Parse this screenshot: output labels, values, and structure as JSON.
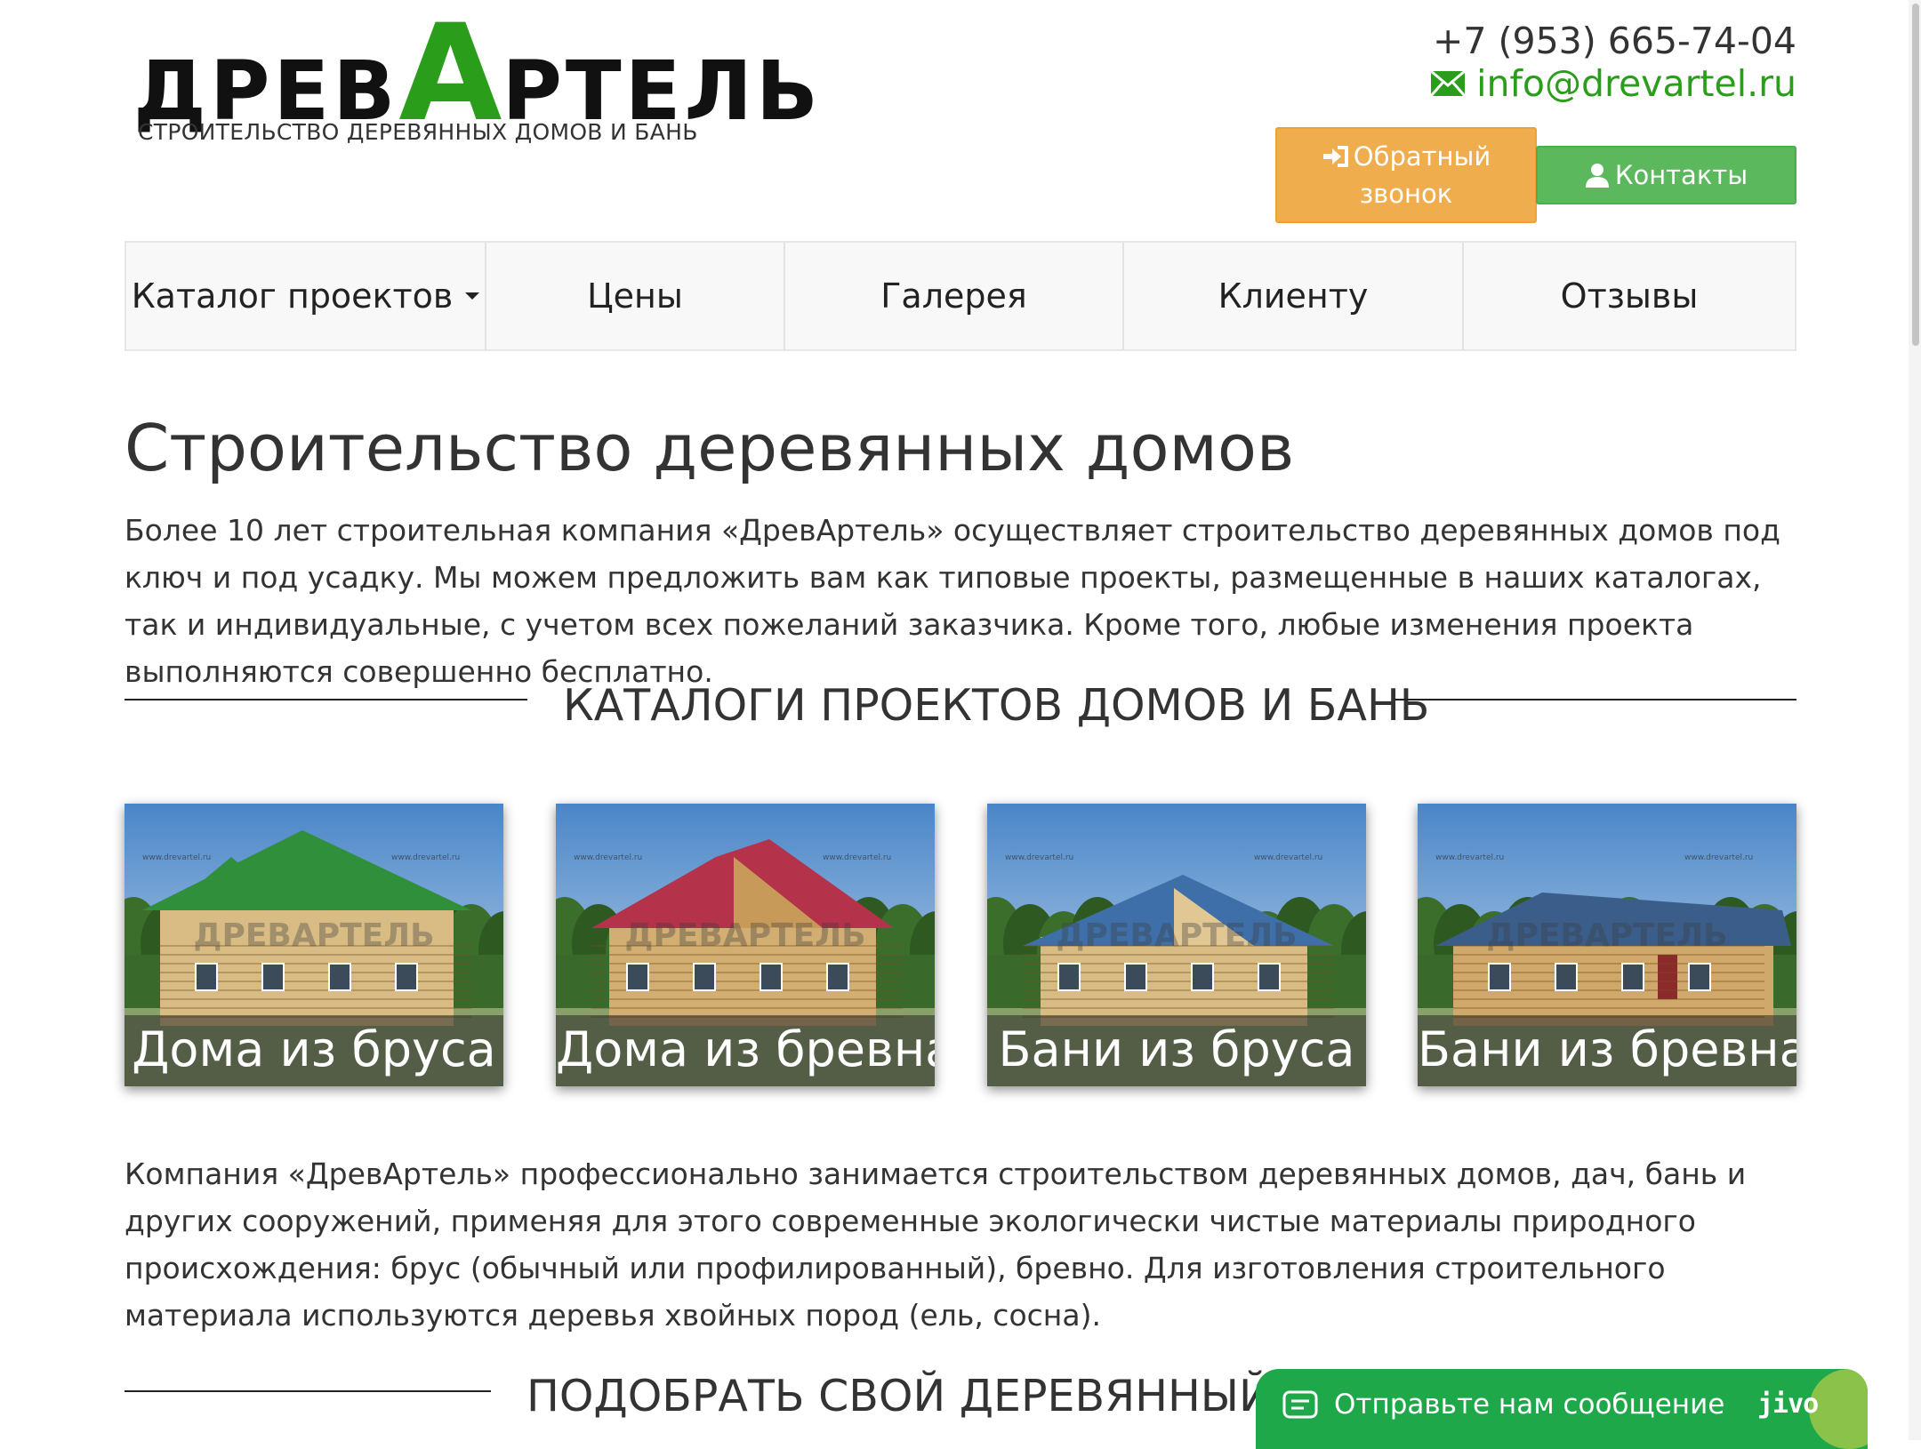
{
  "header": {
    "logo": {
      "part1": "ДРЕВ",
      "letter": "А",
      "part2": "РТЕЛЬ",
      "subtitle": "СТРОИТЕЛЬСТВО ДЕРЕВЯННЫХ ДОМОВ И БАНЬ"
    },
    "phone": "+7 (953) 665-74-04",
    "email": "info@drevartel.ru",
    "callback_button": {
      "line1": "Обратный",
      "line2": "звонок"
    },
    "contacts_button": "Контакты"
  },
  "nav": {
    "items": [
      {
        "label": "Каталог проектов",
        "dropdown": true
      },
      {
        "label": "Цены"
      },
      {
        "label": "Галерея"
      },
      {
        "label": "Клиенту"
      },
      {
        "label": "Отзывы"
      }
    ]
  },
  "main": {
    "title": "Строительство деревянных домов",
    "intro": "Более 10 лет строительная компания «ДревАртель» осуществляет строительство деревянных домов под ключ и под усадку. Мы можем предложить вам как типовые проекты, размещенные в наших каталогах, так и индивидуальные, с учетом всех пожеланий заказчика. Кроме того, любые изменения проекта выполняются совершенно бесплатно.",
    "catalogs_heading": "КАТАЛОГИ ПРОЕКТОВ ДОМОВ И БАНЬ",
    "catalogs": [
      {
        "label": "Дома из бруса",
        "roof_color": "#2f8f3a"
      },
      {
        "label": "Дома из бревна",
        "roof_color": "#b4324a"
      },
      {
        "label": "Бани из бруса",
        "roof_color": "#3f6fa8"
      },
      {
        "label": "Бани из бревна",
        "roof_color": "#3a5d8a"
      }
    ],
    "watermark_text": "www.drevartel.ru",
    "watermark_logo": "ДРЕВАРТЕЛЬ",
    "company_text": "Компания «ДревАртель» профессионально занимается строительством деревянных домов, дач, бань и других сооружений, применяя для этого современные экологически чистые материалы природного происхождения: брус (обычный или профилированный), бревно. Для изготовления строительного материала используются деревья хвойных пород (ель, сосна).",
    "select_heading": "ПОДОБРАТЬ СВОЙ ДЕРЕВЯННЫЙ ДОМ"
  },
  "chat": {
    "text": "Отправьте нам сообщение",
    "brand": "jivo"
  },
  "colors": {
    "accent_green": "#2a9d1b",
    "callback_orange": "#f0ad4e",
    "contacts_green": "#5cb85c",
    "chat_green": "#1fa84a"
  }
}
